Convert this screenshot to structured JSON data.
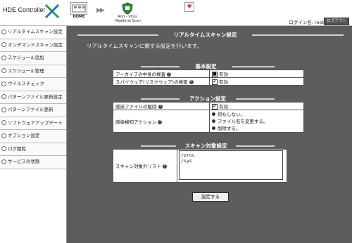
{
  "header": {
    "logo_text": "HDE Controller",
    "tools": [
      {
        "label": "HOME"
      },
      {
        "label": "Anti - Virus\nRealtime Scan"
      }
    ],
    "login_label": "ログイン名: root",
    "logout_label": "ログアウト"
  },
  "sidebar": {
    "items": [
      {
        "label": "リアルタイムスキャン設定"
      },
      {
        "label": "オンデマンドスキャン設定"
      },
      {
        "label": "スケジュール追加"
      },
      {
        "label": "スケジュール管理"
      },
      {
        "label": "ウイルスチェック"
      },
      {
        "label": "パターンファイル更新設定"
      },
      {
        "label": "パターンファイル更新"
      },
      {
        "label": "ソフトウェアアップデート"
      },
      {
        "label": "オプション設定"
      },
      {
        "label": "ログ閲覧"
      },
      {
        "label": "サービスの状態"
      }
    ]
  },
  "main": {
    "page_title": "リアルタイムスキャン設定",
    "description": "リアルタイムスキャンに関する設定を行います。",
    "basic": {
      "title": "基本設定",
      "archive_label": "アーカイブの中身の検査",
      "archive_value": "有効",
      "spyware_label": "スパイウェア(リスクウェア)の検査",
      "spyware_value": "有効"
    },
    "action": {
      "title": "アクション設定",
      "delete_label": "感染ファイルの駆除",
      "delete_value": "有効",
      "detect_label": "感染検知アクション",
      "options": [
        "何もしない。",
        "ファイル名を変更する。",
        "削除する。"
      ]
    },
    "scan_target": {
      "title": "スキャン対象設定",
      "exclude_label": "スキャン対象外リスト",
      "exclude_value": "/proc\n/sys"
    },
    "submit_label": "設定する"
  }
}
